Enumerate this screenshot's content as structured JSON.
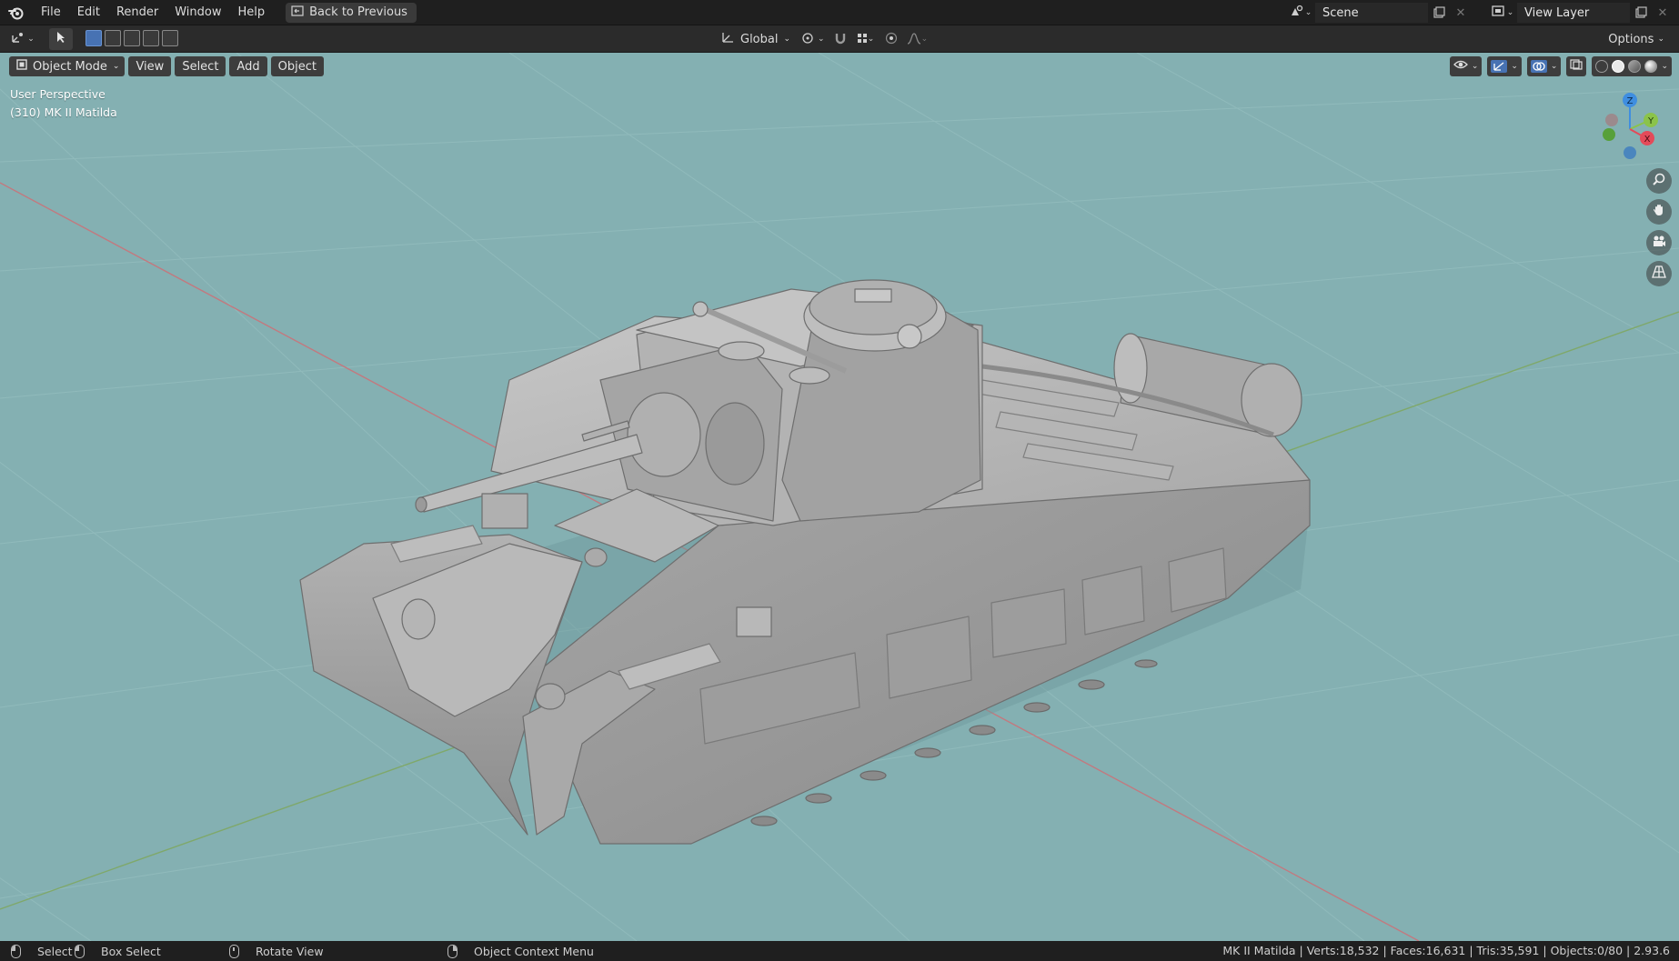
{
  "topbar": {
    "menu": [
      "File",
      "Edit",
      "Render",
      "Window",
      "Help"
    ],
    "back_label": "Back to Previous",
    "scene_name": "Scene",
    "view_layer_name": "View Layer"
  },
  "toolheader": {
    "orientation": "Global",
    "options_label": "Options"
  },
  "viewport": {
    "mode_label": "Object Mode",
    "menu": [
      "View",
      "Select",
      "Add",
      "Object"
    ],
    "perspective_label": "User Perspective",
    "object_label": "(310) MK II Matilda",
    "background_color": "#84b0b2",
    "gizmo_axes": {
      "x": "X",
      "y": "Y",
      "z": "Z"
    },
    "model_description_icon": "tank-model"
  },
  "statusbar": {
    "select_label": "Select",
    "box_select_label": "Box Select",
    "rotate_label": "Rotate View",
    "context_label": "Object Context Menu",
    "stats": "MK II Matilda | Verts:18,532 | Faces:16,631 | Tris:35,591 | Objects:0/80 | 2.93.6"
  },
  "colors": {
    "accent": "#4772b3",
    "axis_x": "#e44a59",
    "axis_y": "#8bc34a",
    "axis_z": "#3f8ee0"
  }
}
